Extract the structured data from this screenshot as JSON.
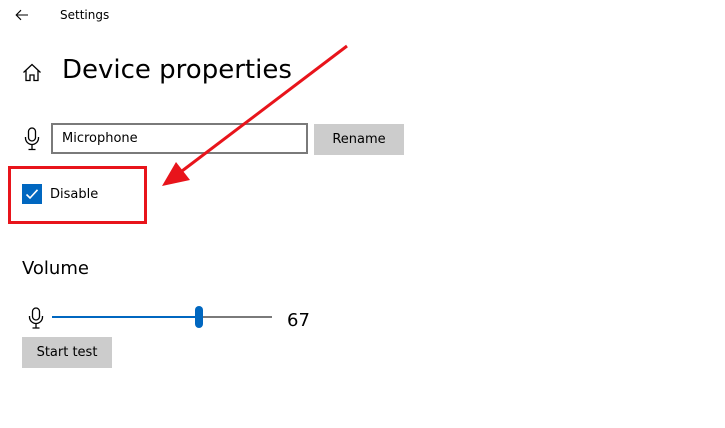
{
  "window": {
    "title": "Settings",
    "back_icon": "back-arrow-icon"
  },
  "header": {
    "home_icon": "home-icon",
    "title": "Device properties"
  },
  "device": {
    "icon": "microphone-icon",
    "name_value": "Microphone",
    "rename_label": "Rename"
  },
  "disable": {
    "label": "Disable",
    "checked": true
  },
  "volume": {
    "title": "Volume",
    "icon": "microphone-icon",
    "value": 67,
    "value_text": "67",
    "start_test_label": "Start test"
  },
  "colors": {
    "accent": "#0067c0",
    "button_bg": "#cccccc",
    "annotation": "#e8141b"
  }
}
